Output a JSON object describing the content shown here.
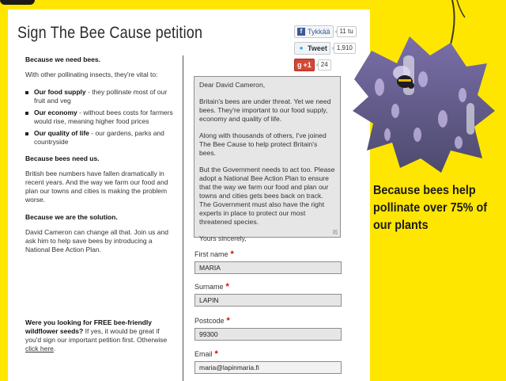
{
  "title": "Sign The Bee Cause petition",
  "social": {
    "facebook": {
      "label": "Tykkää",
      "count": "11 tu"
    },
    "twitter": {
      "label": "Tweet",
      "count": "1,910"
    },
    "google": {
      "label": "+1",
      "count": "24"
    }
  },
  "left": {
    "heading1": "Because we need bees.",
    "intro": "With other pollinating insects, they're vital to:",
    "bullets": [
      {
        "bold": "Our food supply",
        "text": " - they pollinate most of our fruit and veg"
      },
      {
        "bold": "Our economy",
        "text": " - without bees costs for farmers would rise, meaning higher food prices"
      },
      {
        "bold": "Our quality of life",
        "text": " - our gardens, parks and countryside"
      }
    ],
    "heading2": "Because bees need us.",
    "para2": "British bee numbers have fallen dramatically in recent years. And the way we farm our food and plan our towns and cities is making the problem worse.",
    "heading3": "Because we are the solution.",
    "para3": "David Cameron can change all that. Join us and ask him to help save bees by introducing a National Bee Action Plan."
  },
  "seeds": {
    "bold": "Were you looking for FREE bee-friendly wildflower seeds?",
    "text": " If yes, it would be great if you'd sign our important petition first. Otherwise ",
    "link": "click here",
    "end": "."
  },
  "letter": {
    "greeting": "Dear David Cameron,",
    "p1": "Britain's bees are under threat. Yet we need bees. They're important to our food supply, economy and quality of life.",
    "p2": "Along with thousands of others, I've joined The Bee Cause to help protect Britain's bees.",
    "p3": "But the Government needs to act too. Please adopt a National Bee Action Plan to ensure that the way we farm our food and plan our towns and cities gets bees back on track. The Government must also have the right experts in place to protect our most threatened species.",
    "closing": "Yours sincerely,"
  },
  "form": {
    "first_name": {
      "label": "First name",
      "value": "MARIA"
    },
    "surname": {
      "label": "Surname",
      "value": "LAPIN"
    },
    "postcode": {
      "label": "Postcode",
      "value": "99300"
    },
    "email": {
      "label": "Email",
      "value": "maria@lapinmaria.fi"
    },
    "required_mark": "*"
  },
  "banner": "Because bees help pollinate over 75% of our plants",
  "icons": {
    "facebook": "facebook-icon",
    "twitter": "twitter-bird-icon",
    "google": "google-plus-icon",
    "bee": "bee-flower-image"
  }
}
